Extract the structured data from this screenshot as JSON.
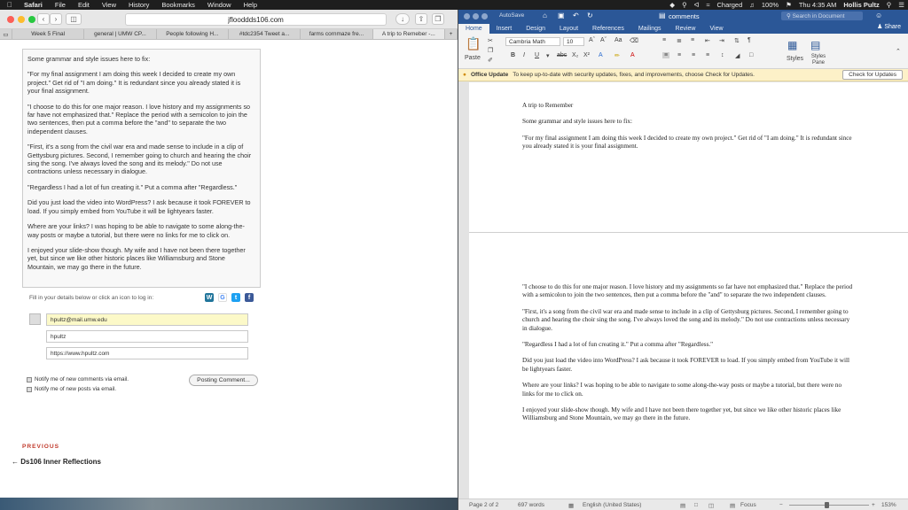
{
  "menubar": {
    "app": "Safari",
    "items": [
      "File",
      "Edit",
      "View",
      "History",
      "Bookmarks",
      "Window",
      "Help"
    ],
    "battery_status": "Charged",
    "battery_pct": "100%",
    "clock": "Thu 4:35 AM",
    "user": "Hollis Pultz"
  },
  "safari": {
    "url": "jflooddds106.com",
    "tabs": [
      "Week 5 Final",
      "general | UMW CP...",
      "People following H...",
      "#tdc2354 Tweet a...",
      "farms cornmaze fre...",
      "A trip to Remeber -..."
    ],
    "comment_paragraphs": [
      "Some grammar and style issues here to fix:",
      "\"For my final assignment I am doing this week I decided to create my own project.\" Get rid of \"I am doing.\" It is redundant since you already stated it is your final assignment.",
      "\"I choose to do this for one major reason. I love history and my assignments so far have not emphasized that.\" Replace the period with a semicolon to join the two sentences, then put a comma before the \"and\" to separate the two independent clauses.",
      "\"First, it's a song from the civil war era and made sense to include in a clip of Gettysburg pictures. Second, I remember going to church and hearing the choir sing the song. I've always loved the song and its melody.\" Do not use contractions unless necessary in dialogue.",
      "\"Regardless I had a lot of fun creating it.\" Put a comma after \"Regardless.\"",
      "Did you just load the video into WordPress? I ask because it took FOREVER to load. If you simply embed from YouTube it will be lightyears faster.",
      "Where are your links? I was hoping to be able to navigate to some along-the-way posts or maybe a tutorial, but there were no links for me to click on.",
      "I enjoyed your slide-show though. My wife and I have not been there together yet, but since we like other historic places like Williamsburg and Stone Mountain, we may go there in the future."
    ],
    "details_label": "Fill in your details below or click an icon to log in:",
    "email_value": "hpultz@mail.umw.edu",
    "name_value": "hpultz",
    "website_value": "https://www.hpultz.com",
    "notify_comments": "Notify me of new comments via email.",
    "notify_posts": "Notify me of new posts via email.",
    "posting_button": "Posting Comment...",
    "previous_label": "PREVIOUS",
    "previous_link": "Ds106 Inner Reflections"
  },
  "word": {
    "autosave": "AutoSave",
    "doc_title": "comments",
    "search_placeholder": "Search in Document",
    "tabs": [
      "Home",
      "Insert",
      "Design",
      "Layout",
      "References",
      "Mailings",
      "Review",
      "View"
    ],
    "share": "Share",
    "paste": "Paste",
    "font_name": "Cambria Math",
    "font_size": "10",
    "styles": "Styles",
    "styles_pane": "Styles Pane",
    "update_title": "Office Update",
    "update_text": "To keep up-to-date with security updates, fixes, and improvements, choose Check for Updates.",
    "update_button": "Check for Updates",
    "page1": [
      "A trip to Remember",
      "Some grammar and style issues here to fix:",
      "\"For my final assignment I am doing this week I decided to create my own project.\" Get rid of \"I am doing.\" It is redundant since you already stated it is your final assignment."
    ],
    "page2": [
      "\"I choose to do this for one major reason. I love history and my assignments so far have not emphasized that.\" Replace the period with a semicolon to join the two sentences, then put a comma before the \"and\" to separate the two independent clauses.",
      "\"First, it's a song from the civil war era and made sense to include in a clip of Gettysburg pictures. Second, I remember going to church and hearing the choir sing the song. I've always loved the song and its melody.\" Do not use contractions unless necessary in dialogue.",
      "\"Regardless I had a lot of fun creating it.\" Put a comma after \"Regardless.\"",
      "Did you just load the video into WordPress? I ask because it took FOREVER to load. If you simply embed from YouTube it will be lightyears faster.",
      "Where are your links? I was hoping to be able to navigate to some along-the-way posts or maybe a tutorial, but there were no links for me to click on.",
      "I enjoyed your slide-show though. My wife and I have not been there together yet, but since we like other historic places like Williamsburg and Stone Mountain, we may go there in the future."
    ],
    "status_page": "Page 2 of 2",
    "status_words": "697 words",
    "status_lang": "English (United States)",
    "status_focus": "Focus",
    "zoom": "153%"
  }
}
